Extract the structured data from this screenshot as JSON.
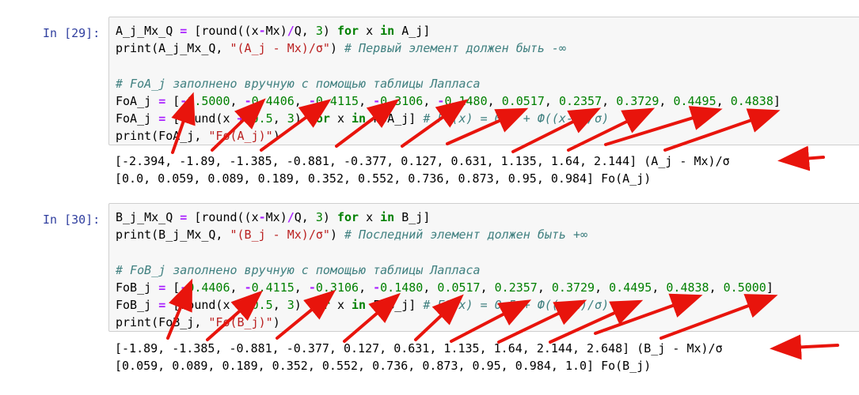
{
  "cells": [
    {
      "prompt": "In [29]:",
      "code": {
        "l1_var": "A_j_Mx_Q",
        "l1_expr_a": "[round((x",
        "l1_expr_b": "Mx)",
        "l1_expr_c": "Q, ",
        "l1_num": "3",
        "l1_expr_d": ") ",
        "l1_for": "for",
        "l1_x": " x ",
        "l1_in": "in",
        "l1_end": " A_j]",
        "l2_a": "print(A_j_Mx_Q, ",
        "l2_str": "\"(A_j - Mx)/σ\"",
        "l2_b": ") ",
        "l2_comment": "# Первый элемент должен быть -∞",
        "l4_comment": "# FoA_j заполнено вручную с помощью таблицы Лапласа",
        "l5_var": "FoA_j",
        "l5_values": [
          "0.5000",
          "0.4406",
          "0.4115",
          "0.3106",
          "0.1480",
          "0.0517",
          "0.2357",
          "0.3729",
          "0.4495",
          "0.4838"
        ],
        "l5_negative_count": 5,
        "l6_var": "FoA_j",
        "l6_a": "[round(x ",
        "l6_num1": "0.5",
        "l6_num2": "3",
        "l6_for": "for",
        "l6_in": "in",
        "l6_end": " FoA_j] ",
        "l6_comment": "# F0(x) = 0.5 + Ф((x-m)/σ)",
        "l7_a": "print(FoA_j, ",
        "l7_str": "\"Fo(A_j)\"",
        "l7_b": ")"
      },
      "output": [
        "[-2.394, -1.89, -1.385, -0.881, -0.377, 0.127, 0.631, 1.135, 1.64, 2.144] (A_j - Mx)/σ",
        "[0.0, 0.059, 0.089, 0.189, 0.352, 0.552, 0.736, 0.873, 0.95, 0.984] Fo(A_j)"
      ]
    },
    {
      "prompt": "In [30]:",
      "code": {
        "l1_var": "B_j_Mx_Q",
        "l1_expr_a": "[round((x",
        "l1_expr_b": "Mx)",
        "l1_expr_c": "Q, ",
        "l1_num": "3",
        "l1_expr_d": ") ",
        "l1_for": "for",
        "l1_x": " x ",
        "l1_in": "in",
        "l1_end": " B_j]",
        "l2_a": "print(B_j_Mx_Q, ",
        "l2_str": "\"(B_j - Mx)/σ\"",
        "l2_b": ") ",
        "l2_comment": "# Последний элемент должен быть +∞",
        "l4_comment": "# FoB_j заполнено вручную с помощью таблицы Лапласа",
        "l5_var": "FoB_j",
        "l5_values": [
          "0.4406",
          "0.4115",
          "0.3106",
          "0.1480",
          "0.0517",
          "0.2357",
          "0.3729",
          "0.4495",
          "0.4838",
          "0.5000"
        ],
        "l5_negative_count": 4,
        "l6_var": "FoB_j",
        "l6_a": "[round(x ",
        "l6_num1": "0.5",
        "l6_num2": "3",
        "l6_for": "for",
        "l6_in": "in",
        "l6_end": " FoB_j] ",
        "l6_comment": "# F0(x) = 0.5 + Ф((x-m)/σ)",
        "l7_a": "print(FoB_j, ",
        "l7_str": "\"Fo(B_j)\"",
        "l7_b": ")"
      },
      "output": [
        "[-1.89, -1.385, -0.881, -0.377, 0.127, 0.631, 1.135, 1.64, 2.144, 2.648] (B_j - Mx)/σ",
        "[0.059, 0.089, 0.189, 0.352, 0.552, 0.736, 0.873, 0.95, 0.984, 1.0] Fo(B_j)"
      ]
    }
  ],
  "colors": {
    "prompt": "#303f9f",
    "keyword": "#008000",
    "operator": "#aa22ff",
    "number": "#008000",
    "string": "#ba2121",
    "comment": "#408080",
    "annotation_arrow": "#e8140c",
    "cell_background": "#f7f7f7"
  }
}
